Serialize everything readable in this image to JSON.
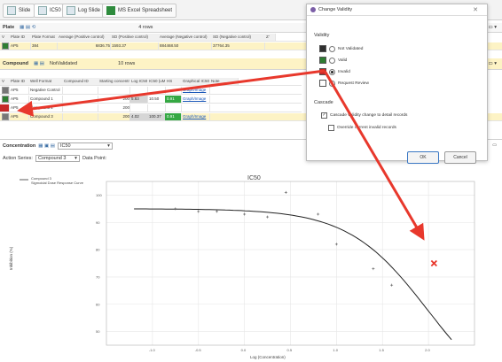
{
  "tabs": [
    {
      "label": "Slide"
    },
    {
      "label": "IC50"
    },
    {
      "label": "Log Slide"
    },
    {
      "label": "MS Excel Spreadsheet"
    }
  ],
  "plate": {
    "title": "Plate",
    "row_count": "4 rows",
    "columns": [
      "V",
      "Plate ID",
      "Plate Format",
      "Average (Positive control)",
      "SD (Positive control)",
      "Average (Negative control)",
      "SD (Negative control)",
      "Z'"
    ],
    "row": [
      "",
      "AP5",
      "384",
      "6836.75",
      "1593.37",
      "884468.50",
      "37764.35",
      ""
    ]
  },
  "compound": {
    "title": "Compound",
    "status": "NotValidated",
    "row_count": "10 rows",
    "columns": [
      "V",
      "Plate ID",
      "Well Format",
      "Compound ID",
      "Starting concentra..",
      "Log IC50",
      "IC50 (uM)",
      "HS",
      "Graphical IC50",
      "Note"
    ],
    "rows": [
      {
        "plate": "AP5",
        "well": "Negative Control",
        "start": "",
        "log": "",
        "ic50": "",
        "hs": "",
        "graph": "Graph/Image",
        "status": "gray"
      },
      {
        "plate": "AP5",
        "well": "Compound 1",
        "start": "200",
        "log": "5.83",
        "ic50": "10.50",
        "hs": "0.91",
        "graph": "Graph/Image",
        "status": "green"
      },
      {
        "plate": "AP5",
        "well": "Compound 2",
        "start": "200",
        "log": "",
        "ic50": "",
        "hs": "",
        "graph": "",
        "status": "red"
      },
      {
        "plate": "AP5",
        "well": "Compound 3",
        "start": "200",
        "log": "4.02",
        "ic50": "100.37",
        "hs": "0.91",
        "graph": "Graph/Image",
        "status": "gray"
      }
    ]
  },
  "concentration": {
    "label": "Concentration",
    "selector": "IC50",
    "action_series_label": "Action Series:",
    "action_series_value": "Compound 3",
    "data_point_label": "Data Point:"
  },
  "chart_data": {
    "type": "scatter",
    "title": "IC50",
    "xlabel": "Log (Concentration)",
    "ylabel": "Inhibition (%)",
    "legend": [
      "Compound 3",
      "Sigmoidal Dose Response Curve"
    ],
    "legend_position": "top-left",
    "xlim": [
      -1.5,
      2.5
    ],
    "ylim": [
      45,
      105
    ],
    "xticks": [
      -1.0,
      -0.5,
      0.0,
      0.5,
      1.0,
      1.5,
      2.0
    ],
    "yticks": [
      50,
      60,
      70,
      80,
      90,
      100
    ],
    "points": [
      {
        "x": -0.75,
        "y": 95
      },
      {
        "x": -0.5,
        "y": 94
      },
      {
        "x": -0.3,
        "y": 94
      },
      {
        "x": 0.0,
        "y": 93
      },
      {
        "x": 0.25,
        "y": 92
      },
      {
        "x": 0.45,
        "y": 101
      },
      {
        "x": 0.8,
        "y": 93
      },
      {
        "x": 1.0,
        "y": 82
      },
      {
        "x": 1.4,
        "y": 73
      },
      {
        "x": 1.6,
        "y": 67
      }
    ],
    "curve": {
      "top": 95,
      "bottom": 20,
      "log_ec50": 2.0,
      "hill": 1.0,
      "x_start": -1.2,
      "x_end": 2.25
    },
    "marker": {
      "x": 2.06,
      "y": 75
    }
  },
  "dialog": {
    "title": "Change Validity",
    "close": "✕",
    "validity_label": "Validity",
    "options": [
      {
        "label": "Not Validated",
        "color": "#2f2f2f"
      },
      {
        "label": "Valid",
        "color": "#2e7d32"
      },
      {
        "label": "Invalid",
        "color": "#c62828"
      },
      {
        "label": "Request Review",
        "color": "#ffffff"
      }
    ],
    "cascade_label": "Cascade",
    "cascade_options": [
      "Cascade validity change to detail records",
      "Override current invalid records"
    ],
    "ok": "OK",
    "cancel": "Cancel"
  },
  "colors": {
    "accent": "#e8382c",
    "valid": "#2e7d32",
    "invalid": "#c62828",
    "highlight": "#fdf3c5"
  }
}
